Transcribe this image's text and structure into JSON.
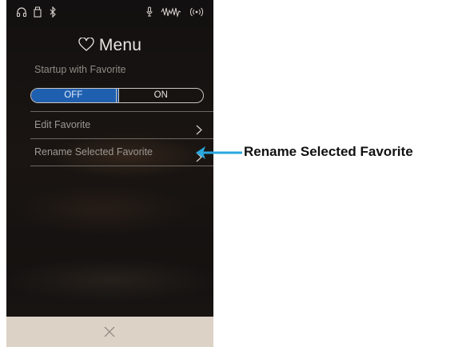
{
  "menu": {
    "title": "Menu",
    "startup_label": "Startup with Favorite",
    "toggle": {
      "off_label": "OFF",
      "on_label": "ON",
      "selected": "OFF"
    },
    "items": [
      {
        "label": "Edit Favorite"
      },
      {
        "label": "Rename Selected Favorite"
      }
    ]
  },
  "status_icons": [
    "headphones-icon",
    "usb-icon",
    "bluetooth-icon",
    "microphone-icon",
    "wave-icon",
    "wireless-icon"
  ],
  "annotation": {
    "label": "Rename Selected Favorite"
  },
  "colors": {
    "accent": "#1f5fb0",
    "callout": "#2aa8e0",
    "footer": "#ddd2c6"
  }
}
